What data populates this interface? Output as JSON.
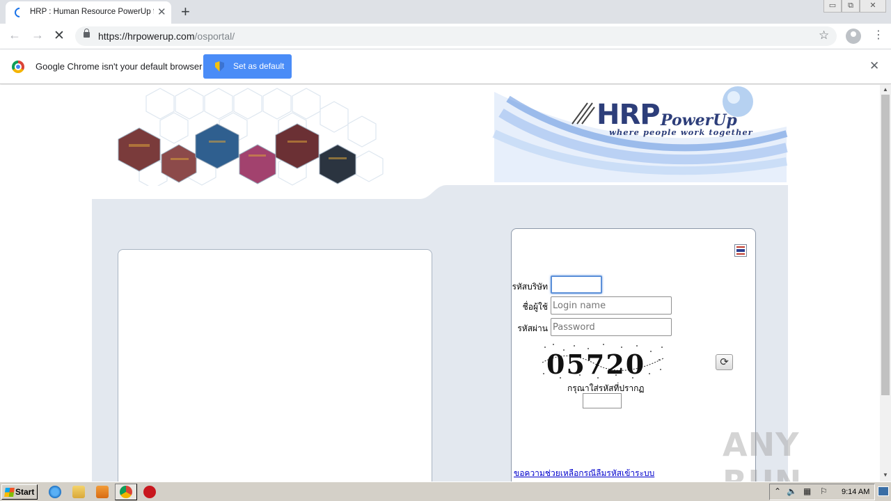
{
  "browser": {
    "tab_title": "HRP : Human Resource PowerUp for",
    "tab_close": "✕",
    "new_tab": "+",
    "url_host": "https://hrpowerup.com",
    "url_path": "/osportal/",
    "window_controls": [
      "▭",
      "⧉",
      "✕"
    ]
  },
  "infobar": {
    "message": "Google Chrome isn't your default browser",
    "button_label": "Set as default",
    "close": "✕"
  },
  "logo": {
    "brand": "HRP",
    "product": "PowerUp",
    "tagline": "where people work together"
  },
  "login": {
    "company_label": "รหัสบริษัท",
    "company_value": "",
    "username_label": "ชื่อผู้ใช้",
    "username_placeholder": "Login name",
    "password_label": "รหัสผ่าน",
    "password_placeholder": "Password",
    "captcha_text": "05720",
    "captcha_hint": "กรุณาใส่รหัสที่ปรากฏ",
    "refresh": "⟳",
    "help_link": "ขอความช่วยเหลือกรณีลืมรหัสเข้าระบบ"
  },
  "watermark": "ANY RUN",
  "taskbar": {
    "start_label": "Start",
    "clock": "9:14 AM"
  },
  "icons": [
    "chrome-logo-icon",
    "shield-icon",
    "lock-icon",
    "star-icon",
    "refresh-icon",
    "thai-flag-icon"
  ],
  "colors": {
    "accent": "#4a8cf7",
    "brand": "#2d3e7a",
    "content_bg": "#e3e8ef"
  }
}
